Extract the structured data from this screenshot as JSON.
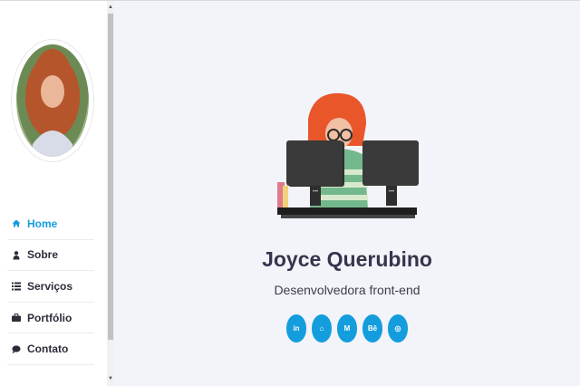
{
  "sidebar": {
    "items": [
      {
        "label": "Home",
        "icon": "home-icon",
        "active": true
      },
      {
        "label": "Sobre",
        "icon": "user-icon",
        "active": false
      },
      {
        "label": "Serviços",
        "icon": "list-icon",
        "active": false
      },
      {
        "label": "Portfólio",
        "icon": "briefcase-icon",
        "active": false
      },
      {
        "label": "Contato",
        "icon": "chat-icon",
        "active": false
      }
    ]
  },
  "hero": {
    "name": "Joyce Querubino",
    "role": "Desenvolvedora front-end"
  },
  "socials": [
    {
      "label": "in",
      "icon": "linkedin-icon"
    },
    {
      "label": "⌂",
      "icon": "github-icon"
    },
    {
      "label": "M",
      "icon": "medium-icon"
    },
    {
      "label": "Bē",
      "icon": "behance-icon"
    },
    {
      "label": "◎",
      "icon": "dribbble-icon"
    }
  ],
  "colors": {
    "accent": "#149ddd",
    "text": "#35364d",
    "background": "#f3f4f9"
  }
}
